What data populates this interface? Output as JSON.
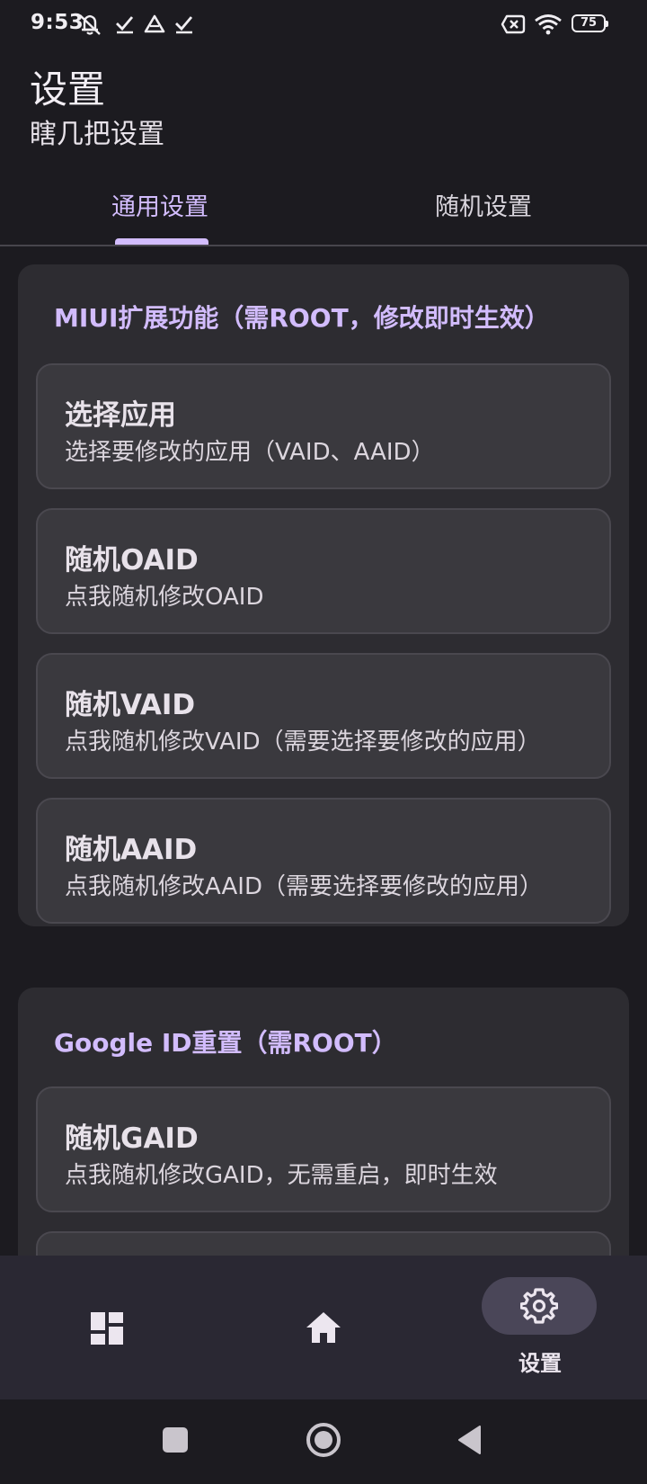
{
  "status_bar": {
    "time": "9:53",
    "battery": "75",
    "icons": [
      "notifications-off-icon",
      "check-icon",
      "drive-icon",
      "check-icon",
      "sim-missing-icon",
      "wifi-icon",
      "battery-icon"
    ]
  },
  "header": {
    "title": "设置",
    "subtitle": "瞎几把设置"
  },
  "tabs": [
    {
      "label": "通用设置",
      "selected": true
    },
    {
      "label": "随机设置",
      "selected": false
    }
  ],
  "sections": [
    {
      "title": "MIUI扩展功能（需ROOT，修改即时生效）",
      "items": [
        {
          "title": "选择应用",
          "description": "选择要修改的应用（VAID、AAID）"
        },
        {
          "title": "随机OAID",
          "description": "点我随机修改OAID"
        },
        {
          "title": "随机VAID",
          "description": "点我随机修改VAID（需要选择要修改的应用）"
        },
        {
          "title": "随机AAID",
          "description": "点我随机修改AAID（需要选择要修改的应用）"
        }
      ]
    },
    {
      "title": "Google ID重置（需ROOT）",
      "items": [
        {
          "title": "随机GAID",
          "description": "点我随机修改GAID，无需重启，即时生效"
        }
      ]
    }
  ],
  "bottom_nav": {
    "items": [
      {
        "icon": "dashboard-icon",
        "label": ""
      },
      {
        "icon": "home-icon",
        "label": ""
      },
      {
        "icon": "settings-icon",
        "label": "设置",
        "selected": true
      }
    ]
  },
  "system_nav": [
    "recents-button",
    "home-button",
    "back-button"
  ],
  "colors": {
    "background": "#1c1b20",
    "accent": "#d2bcfd",
    "card": "#2d2c31",
    "item": "#3a393e",
    "bottom_nav": "#2a2833"
  }
}
